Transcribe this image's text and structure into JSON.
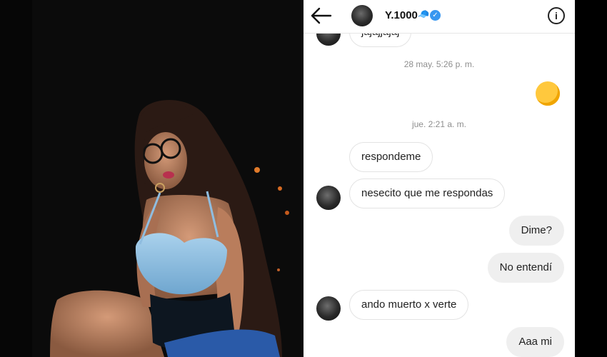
{
  "header": {
    "username": "Y.1000",
    "username_emoji": "🧢",
    "back_icon": "arrow-left-icon",
    "info_icon": "info-icon",
    "verified_icon": "verified-badge-icon"
  },
  "thread": {
    "partial_message": "jajajjajaj",
    "timestamp_1": "28 may. 5:26 p. m.",
    "sent_emoji": "🤭",
    "timestamp_2": "jue. 2:21 a. m.",
    "messages": [
      {
        "text": "respondeme",
        "side": "received"
      },
      {
        "text": "nesecito que me respondas",
        "side": "received"
      },
      {
        "text": "Dime?",
        "side": "sent"
      },
      {
        "text": "No entendí",
        "side": "sent"
      },
      {
        "text": "ando muerto x verte",
        "side": "received"
      },
      {
        "text": "Aaa mi",
        "side": "sent"
      }
    ]
  },
  "colors": {
    "verified": "#3897f0",
    "received_bubble": "#ffffff",
    "sent_bubble": "#efefef"
  }
}
